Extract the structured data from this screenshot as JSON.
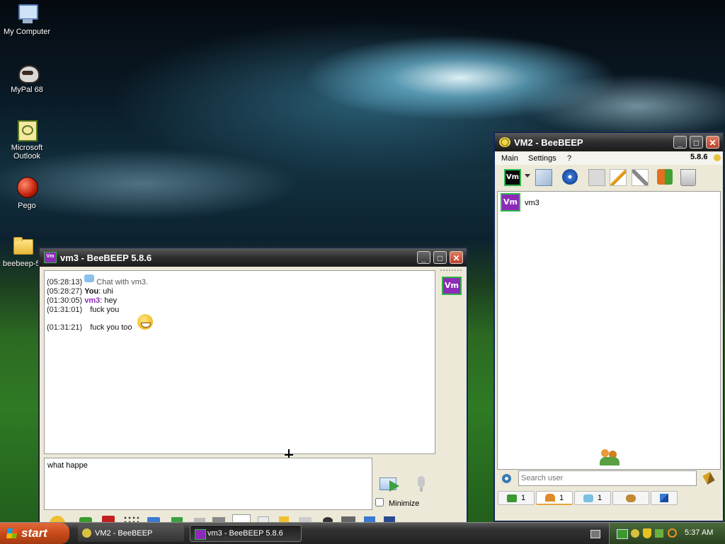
{
  "desktop": {
    "icons": [
      {
        "label": "My Computer"
      },
      {
        "label": "MyPal 68"
      },
      {
        "label": "Microsoft Outlook"
      },
      {
        "label": "Pego"
      },
      {
        "label": "beebeep-5"
      }
    ]
  },
  "chat_window": {
    "title": "vm3 - BeeBEEP 5.8.6",
    "messages": [
      {
        "time": "(05:28:13)",
        "text": "Chat with vm3."
      },
      {
        "time": "(05:28:27)",
        "sender": "You",
        "text": ": uhi"
      },
      {
        "time": "(01:30:05)",
        "sender": "vm3",
        "text": ": hey"
      },
      {
        "time": "(01:31:01)",
        "text": "fuck you"
      },
      {
        "time": "(01:31:21)",
        "text": "fuck you too"
      }
    ],
    "input_value": "what happe",
    "minimize_label": "Minimize",
    "member_badge": "Vm"
  },
  "main_window": {
    "title": "VM2 - BeeBEEP",
    "menu": [
      "Main",
      "Settings",
      "?"
    ],
    "version": "5.8.6",
    "profile_badge": "Vm",
    "users": [
      {
        "badge": "Vm",
        "name": "vm3"
      }
    ],
    "search_placeholder": "Search user",
    "tabs": [
      {
        "icon": "chat-icon",
        "count": "1"
      },
      {
        "icon": "users-icon",
        "count": "1"
      },
      {
        "icon": "group-icon",
        "count": "1"
      },
      {
        "icon": "meeting-icon",
        "count": ""
      },
      {
        "icon": "file-transfer-icon",
        "count": ""
      }
    ]
  },
  "taskbar": {
    "start_label": "start",
    "items": [
      {
        "label": "VM2 - BeeBEEP"
      },
      {
        "label": "vm3 - BeeBEEP 5.8.6"
      }
    ],
    "clock": "5:37 AM"
  },
  "colors": {
    "accent_purple": "#8c2bb8",
    "badge_border": "#2fb54a",
    "start_orange": "#c44818"
  }
}
